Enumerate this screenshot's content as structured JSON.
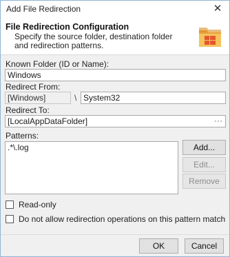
{
  "window": {
    "title": "Add File Redirection"
  },
  "header": {
    "title": "File Redirection Configuration",
    "description": "Specify the source folder, destination folder and redirection patterns."
  },
  "known_folder": {
    "label": "Known Folder (ID or Name):",
    "value": "Windows"
  },
  "redirect_from": {
    "label": "Redirect From:",
    "prefix_value": "[Windows]",
    "separator": "\\",
    "path_value": "System32"
  },
  "redirect_to": {
    "label": "Redirect To:",
    "value": "[LocalAppDataFolder]",
    "browse_label": "···"
  },
  "patterns": {
    "label": "Patterns:",
    "items": [
      ".*\\.log"
    ],
    "add_label": "Add...",
    "edit_label": "Edit...",
    "remove_label": "Remove"
  },
  "options": {
    "readonly_label": "Read-only",
    "no_redirect_label": "Do not allow redirection operations on this pattern match"
  },
  "footer": {
    "ok_label": "OK",
    "cancel_label": "Cancel"
  },
  "icons": {
    "close": "close-icon",
    "header": "folder-windows-icon"
  },
  "colors": {
    "accent_orange": "#e8a23c",
    "logo_red": "#e4572e"
  }
}
